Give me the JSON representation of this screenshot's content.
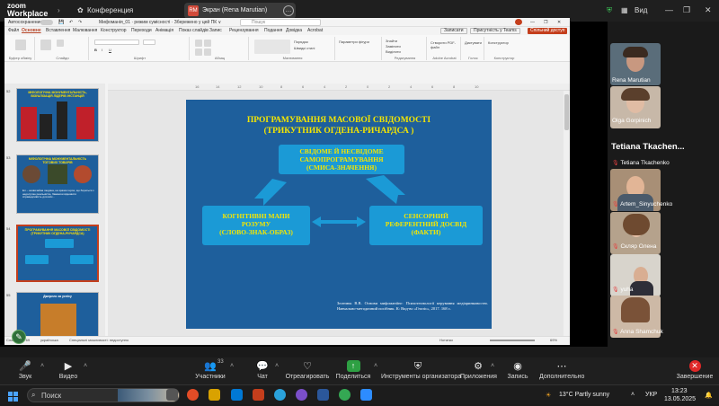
{
  "zoom": {
    "logo_line1": "zoom",
    "logo_line2": "Workplace",
    "conference_label": "Конференция",
    "share_avatar": "RM",
    "share_label": "Экран (Rena Marutian)",
    "view_label": "Вид"
  },
  "ppt": {
    "autosave": "Автосохранение",
    "filename": "Мифоманія_01 · режим сумісності · Збережено у цей ПК ∨",
    "search_placeholder": "Пошук",
    "menu": [
      "Файл",
      "Основне",
      "Вставлення",
      "Малювання",
      "Конструктор",
      "Переходи",
      "Анімація",
      "Показ слайдів",
      "Запис",
      "Рецензування",
      "Подання",
      "Довідка",
      "Acrobat"
    ],
    "active_menu": "Основне",
    "btn_record": "Записати",
    "btn_present": "Присутність у Teams",
    "btn_share": "Спільний доступ",
    "ribbon_groups": [
      "Буфер обміну",
      "Слайди",
      "Шрифт",
      "Абзац",
      "Малювання",
      "Редагування",
      "Adobe Acrobat",
      "Голос",
      "Конструктор"
    ],
    "ribbon_texts": [
      "Знайти",
      "Замінити",
      "Виділити",
      "Створити PDF-файл",
      "Диктувати",
      "Конструктор",
      "Порядок",
      "Швидкі стилі",
      "Параметри фігури"
    ],
    "ruler_marks": [
      "16",
      "14",
      "12",
      "10",
      "8",
      "6",
      "4",
      "2",
      "0",
      "2",
      "4",
      "6",
      "8",
      "10",
      "12",
      "14",
      "16"
    ],
    "status_left": "Слайд 54 з 69",
    "status_lang": "українська",
    "status_access": "Спеціальні можливості: недоступно",
    "status_notes": "Нотатки",
    "zoom_level": "69%"
  },
  "thumbs": [
    {
      "num": "52",
      "title": "МІФОЛОГІЧНА МОНУМЕНТАЛЬНІСТЬ, ВІЗУАЛІЗАЦІЯ ЛІДЕРІВ ІНСТАНЦІЙ"
    },
    {
      "num": "53",
      "title": "МІФОЛОГІЧНА МОНУМЕНТАЛЬНІСТЬ ТОГОВИХ ТОВАРІВ",
      "body": "Ел – незвичайна людина, на зразок героя, що бореться з недолугою реальністю, бажаючи відновити справедливість для всіх..."
    },
    {
      "num": "54",
      "title": "ПРОГРАМУВАННЯ МАСОВОЇ СВІДОМОСТІ (ТРИКУТНИК ОГДЕНА-РИЧАРДСА)"
    },
    {
      "num": "55",
      "title": "Джерело за успіху"
    }
  ],
  "slide": {
    "title_line1": "ПРОГРАМУВАННЯ МАСОВОЇ СВІДОМОСТІ",
    "title_line2": "(ТРИКУТНИК ОГДЕНА-РИЧАРДСА )",
    "box_top": [
      "СВІДОМЕ Й НЕСВІДОМЕ",
      "САМОПРОГРАМУВАННЯ",
      "(СМИСА-ЗНАЧЕННЯ)"
    ],
    "box_left": [
      "КОГНІТИВНІ МАПИ",
      "РОЗУМУ",
      "(СЛОВО-ЗНАК-ОБРАЗ)"
    ],
    "box_right": [
      "СЕНСОРНИЙ",
      "РЕФЕРЕНТНИЙ ДОСВІД",
      "(ФАКТИ)"
    ],
    "caption": "Зелепюк В.В. Основи мифоманіїнг: Психотехнології керування медіаринковостю. Навчально-методичний посібник. К: Вид-во «Гнозіс», 2017. 168 с."
  },
  "participants": [
    {
      "name": "Rena Marutian",
      "muted": false
    },
    {
      "name": "Olga Gorpinich",
      "muted": false
    },
    {
      "name": "Tetiana Tkachenko",
      "muted": true
    },
    {
      "name": "Artem_Sinyuchenko",
      "muted": true
    },
    {
      "name": "Скляр Олена",
      "muted": true
    },
    {
      "name": "yuha",
      "muted": true
    },
    {
      "name": "Anna Shamchuk",
      "muted": true
    }
  ],
  "big_name": "Tetiana  Tkachen...",
  "toolbar": {
    "audio": "Звук",
    "video": "Видео",
    "participants": "Участники",
    "participants_count": "33",
    "chat": "Чат",
    "react": "Отреагировать",
    "share": "Поделиться",
    "host_tools": "Инструменты организатора",
    "apps": "Приложения",
    "record": "Запись",
    "more": "Дополнительно",
    "end": "Завершение"
  },
  "taskbar": {
    "search": "Поиск",
    "weather": "13°C  Partly sunny",
    "lang": "УКР",
    "time": "13:23",
    "date": "13.05.2025"
  }
}
